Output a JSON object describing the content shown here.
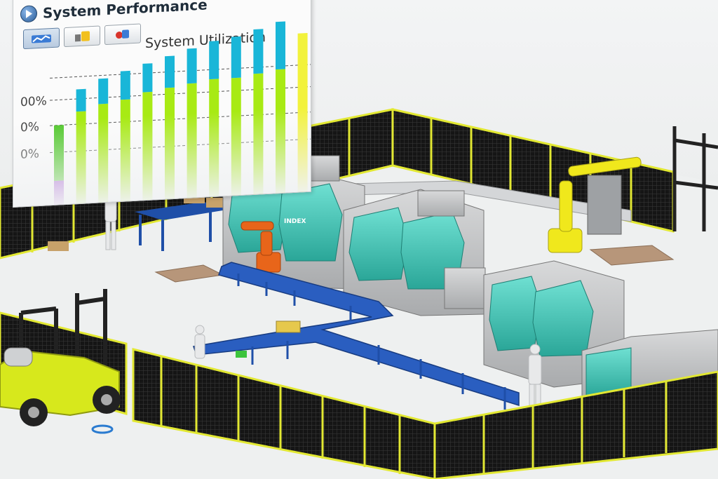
{
  "window": {
    "title": "System Performance",
    "toolbar": [
      {
        "icon": "utilization-chart-icon",
        "active": true
      },
      {
        "icon": "machine-status-icon",
        "active": false
      },
      {
        "icon": "robot-status-icon",
        "active": false
      }
    ]
  },
  "chart_data": {
    "type": "bar",
    "title": "System Utilization",
    "stacked": true,
    "y_tick_labels": [
      "00%",
      "0%",
      "0%"
    ],
    "series_colors": [
      "#a14fd0",
      "#51c82b",
      "#a8ea14",
      "#19b6d8",
      "#f2f23c"
    ],
    "bars": [
      {
        "segments": [
          0.15,
          0.35,
          0.0,
          0.0,
          0.0
        ]
      },
      {
        "segments": [
          0.0,
          0.0,
          0.58,
          0.14,
          0.0
        ]
      },
      {
        "segments": [
          0.0,
          0.0,
          0.62,
          0.16,
          0.0
        ]
      },
      {
        "segments": [
          0.0,
          0.0,
          0.64,
          0.18,
          0.0
        ]
      },
      {
        "segments": [
          0.0,
          0.0,
          0.68,
          0.18,
          0.0
        ]
      },
      {
        "segments": [
          0.0,
          0.0,
          0.7,
          0.2,
          0.0
        ]
      },
      {
        "segments": [
          0.0,
          0.0,
          0.72,
          0.22,
          0.0
        ]
      },
      {
        "segments": [
          0.0,
          0.0,
          0.74,
          0.24,
          0.0
        ]
      },
      {
        "segments": [
          0.0,
          0.0,
          0.74,
          0.26,
          0.0
        ]
      },
      {
        "segments": [
          0.0,
          0.0,
          0.76,
          0.28,
          0.0
        ]
      },
      {
        "segments": [
          0.0,
          0.0,
          0.78,
          0.3,
          0.0
        ]
      },
      {
        "segments": [
          0.0,
          0.0,
          0.0,
          0.0,
          1.0
        ]
      }
    ]
  },
  "scene": {
    "machine_brand": "INDEX",
    "floor_color": "#eef0f0",
    "fence_color": "#e2e832",
    "machine_color": "#3bbfb0",
    "robot_orange": "#e8651a",
    "robot_yellow": "#f0e81c",
    "forklift_color": "#d7e81c",
    "conveyor_color": "#1f4fa8"
  }
}
